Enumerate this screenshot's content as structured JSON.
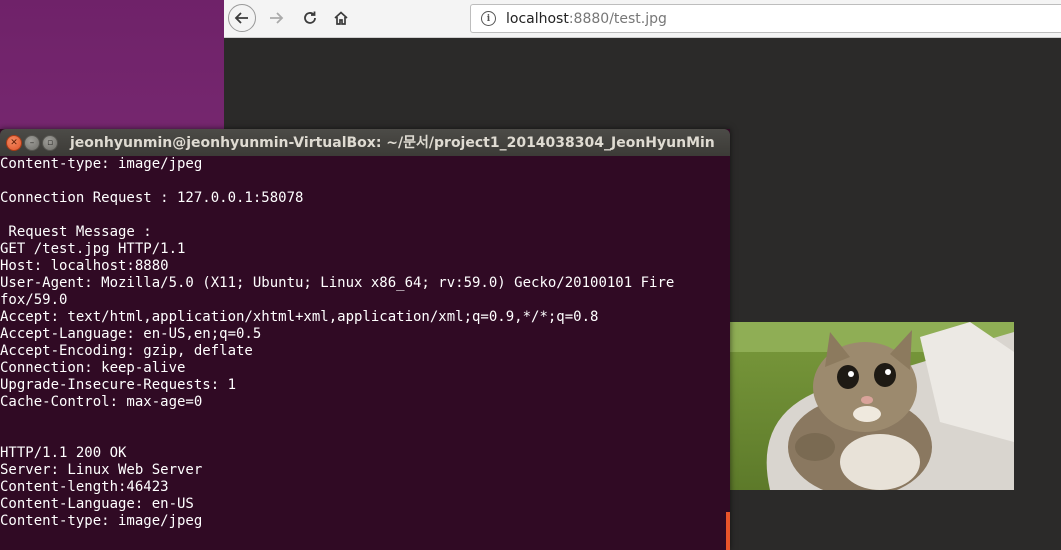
{
  "browser": {
    "url_host": "localhost",
    "url_rest": ":8880/test.jpg",
    "icons": {
      "back": "arrow-left-icon",
      "forward": "arrow-right-icon",
      "reload": "reload-icon",
      "home": "home-icon",
      "info": "info-icon"
    }
  },
  "terminal": {
    "title": "jeonhyunmin@jeonhyunmin-VirtualBox: ~/문서/project1_2014038304_JeonHyunMin",
    "lines": [
      "Content-type: image/jpeg",
      "",
      "Connection Request : 127.0.0.1:58078",
      "",
      " Request Message :",
      "GET /test.jpg HTTP/1.1",
      "Host: localhost:8880",
      "User-Agent: Mozilla/5.0 (X11; Ubuntu; Linux x86_64; rv:59.0) Gecko/20100101 Fire",
      "fox/59.0",
      "Accept: text/html,application/xhtml+xml,application/xml;q=0.9,*/*;q=0.8",
      "Accept-Language: en-US,en;q=0.5",
      "Accept-Encoding: gzip, deflate",
      "Connection: keep-alive",
      "Upgrade-Insecure-Requests: 1",
      "Cache-Control: max-age=0",
      "",
      "",
      "HTTP/1.1 200 OK",
      "Server: Linux Web Server",
      "Content-length:46423",
      "Content-Language: en-US",
      "Content-type: image/jpeg"
    ]
  },
  "colors": {
    "terminal_bg": "#300a24",
    "desktop_purple": "#772a71",
    "viewer_bg": "#2b2a29",
    "accent_orange": "#e9542a"
  }
}
